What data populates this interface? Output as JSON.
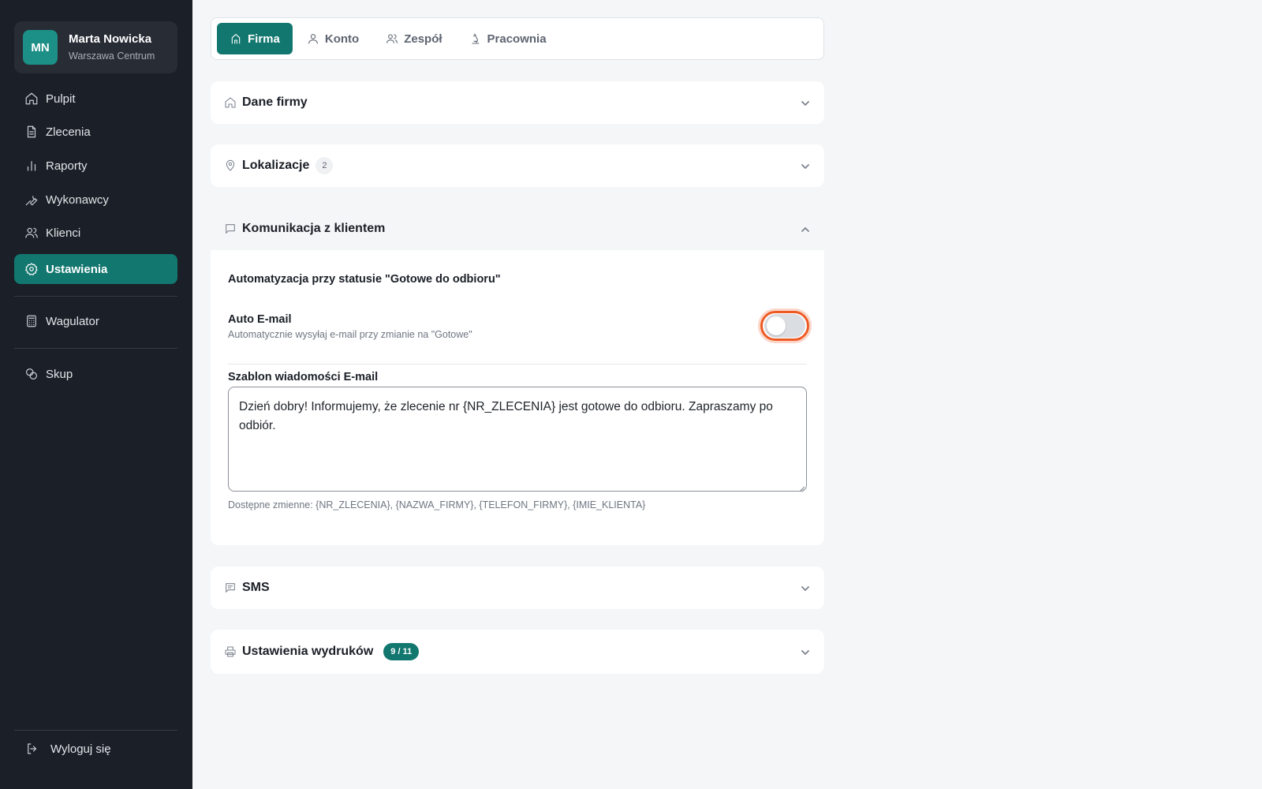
{
  "profile": {
    "initials": "MN",
    "name": "Marta Nowicka",
    "location": "Warszawa Centrum"
  },
  "sidebar": {
    "items": [
      {
        "label": "Pulpit",
        "icon": "home-icon"
      },
      {
        "label": "Zlecenia",
        "icon": "document-icon"
      },
      {
        "label": "Raporty",
        "icon": "bar-chart-icon"
      },
      {
        "label": "Wykonawcy",
        "icon": "wrench-icon"
      },
      {
        "label": "Klienci",
        "icon": "users-icon"
      },
      {
        "label": "Ustawienia",
        "icon": "gear-icon",
        "active": true
      }
    ],
    "tools": [
      {
        "label": "Wagulator",
        "icon": "calculator-icon"
      },
      {
        "label": "Skup",
        "icon": "coins-icon"
      }
    ],
    "logout": "Wyloguj się"
  },
  "tabs": [
    {
      "label": "Firma",
      "icon": "building-icon",
      "active": true
    },
    {
      "label": "Konto",
      "icon": "user-icon"
    },
    {
      "label": "Zespół",
      "icon": "users-icon"
    },
    {
      "label": "Pracownia",
      "icon": "microscope-icon"
    }
  ],
  "sections": {
    "company": {
      "title": "Dane firmy",
      "icon": "home-icon"
    },
    "locations": {
      "title": "Lokalizacje",
      "icon": "map-pin-icon",
      "count": "2"
    },
    "communication": {
      "title": "Komunikacja z klientem",
      "icon": "message-icon",
      "subtitle": "Automatyzacja przy statusie \"Gotowe do odbioru\"",
      "auto_email_label": "Auto E-mail",
      "auto_email_desc": "Automatycznie wysyłaj e-mail przy zmianie na \"Gotowe\"",
      "auto_email_enabled": false,
      "template_label": "Szablon wiadomości E-mail",
      "template_value": "Dzień dobry! Informujemy, że zlecenie nr {NR_ZLECENIA} jest gotowe do odbioru. Zapraszamy po odbiór.",
      "variables_hint": "Dostępne zmienne: {NR_ZLECENIA}, {NAZWA_FIRMY}, {TELEFON_FIRMY}, {IMIE_KLIENTA}"
    },
    "sms": {
      "title": "SMS",
      "icon": "message-text-icon"
    },
    "prints": {
      "title": "Ustawienia wydruków",
      "icon": "printer-icon",
      "badge": "9 / 11"
    }
  },
  "colors": {
    "accent": "#12776f",
    "sidebar_bg": "#1b1f27",
    "focus_ring": "#ee5a24"
  }
}
